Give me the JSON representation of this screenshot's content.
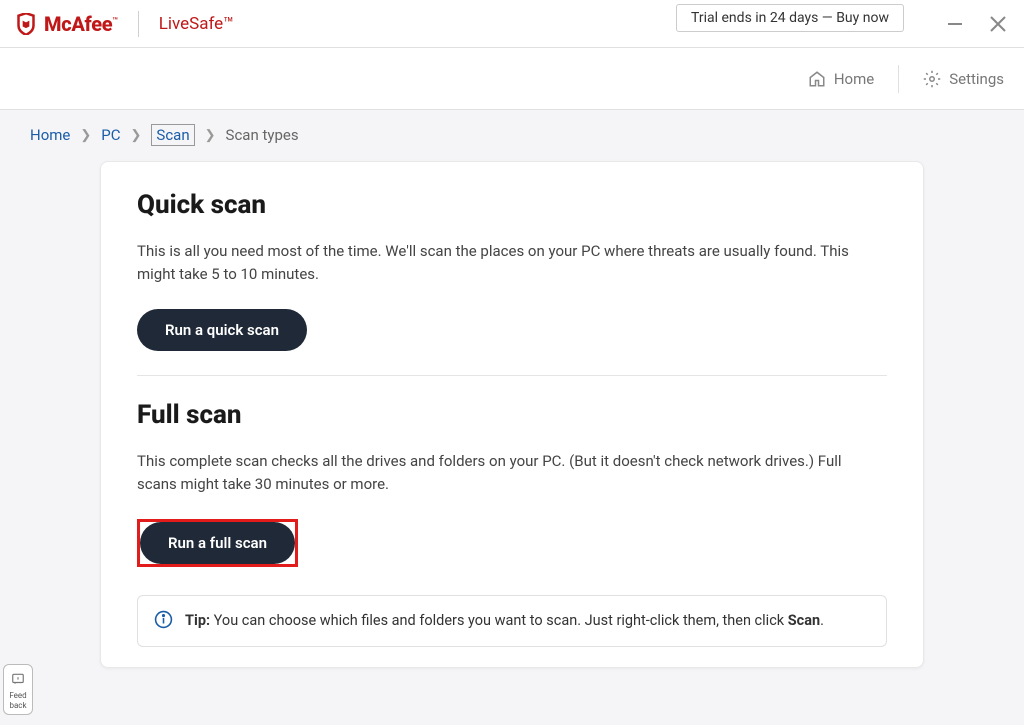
{
  "brand": {
    "name": "McAfee",
    "product": "LiveSafe™"
  },
  "trial": {
    "text": "Trial ends in 24 days — Buy now"
  },
  "nav": {
    "home": "Home",
    "settings": "Settings"
  },
  "breadcrumb": {
    "seg1": "Home",
    "seg2": "PC",
    "seg3": "Scan",
    "seg4": "Scan types"
  },
  "quick": {
    "title": "Quick scan",
    "desc": "This is all you need most of the time. We'll scan the places on your PC where threats are usually found. This might take 5 to 10 minutes.",
    "button": "Run a quick scan"
  },
  "full": {
    "title": "Full scan",
    "desc": "This complete scan checks all the drives and folders on your PC. (But it doesn't check network drives.) Full scans might take 30 minutes or more.",
    "button": "Run a full scan"
  },
  "tip": {
    "label": "Tip:",
    "text": " You can choose which files and folders you want to scan. Just right-click them, then click ",
    "end": "Scan",
    "period": "."
  },
  "feedback": {
    "line1": "Feed",
    "line2": "back"
  }
}
